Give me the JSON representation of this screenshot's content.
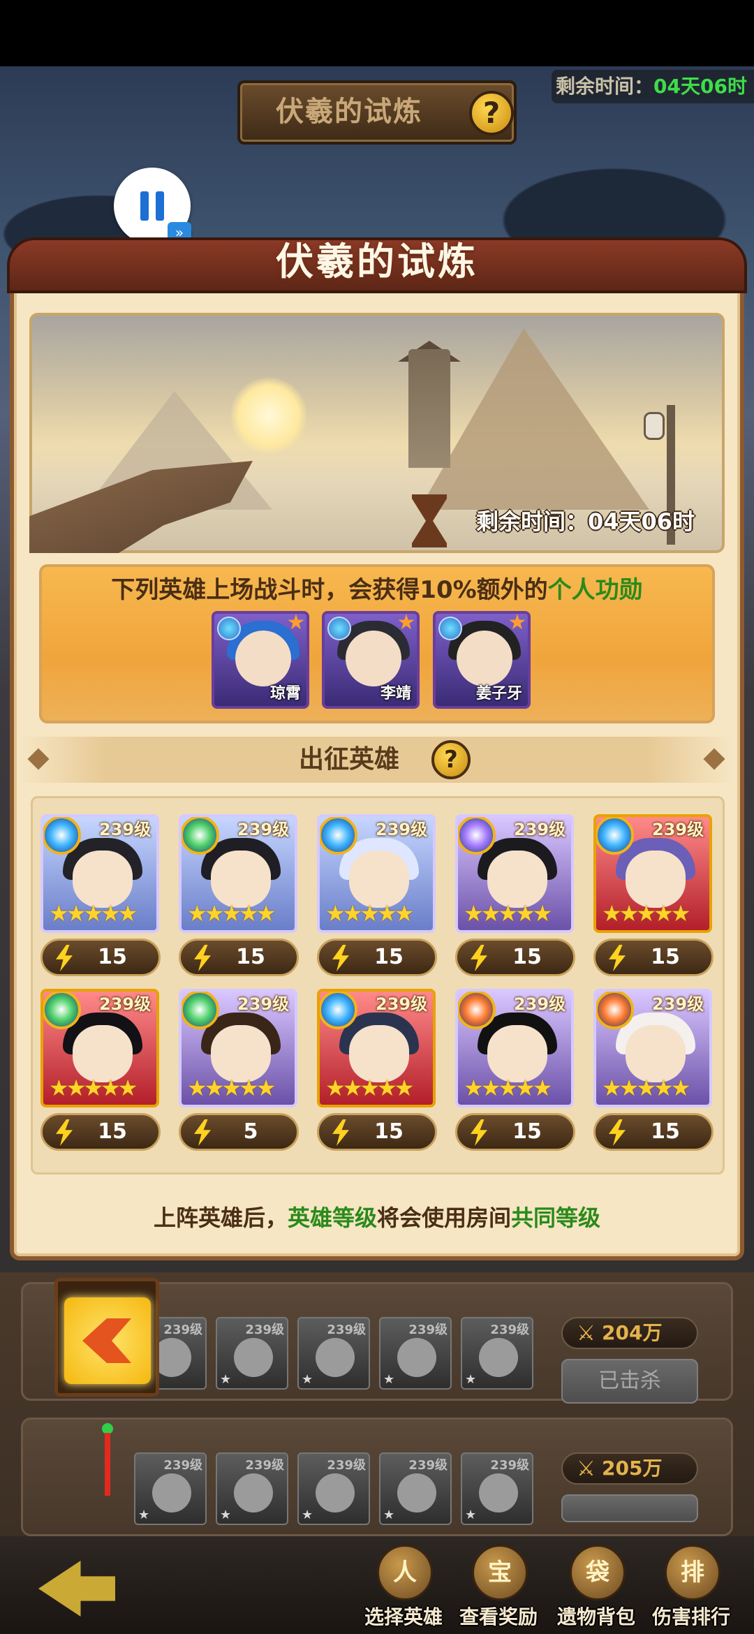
{
  "header": {
    "title": "伏羲的试炼",
    "help_label": "?",
    "remaining_label": "剩余时间：",
    "remaining_value": "04天06时"
  },
  "player": {
    "pause_icon": "pause-icon",
    "fast_forward_icon": "fast-forward-icon"
  },
  "panel": {
    "title": "伏羲的试炼",
    "scene_timer": "剩余时间：04天06时",
    "bonus_text_prefix": "下列英雄上场战斗时，会获得10%额外的",
    "bonus_text_highlight": "个人功勋",
    "bonus_heroes": [
      {
        "name": "琼霄",
        "hair": "#2a6fd1"
      },
      {
        "name": "李靖",
        "hair": "#2b2b33"
      },
      {
        "name": "姜子牙",
        "hair": "#222222"
      }
    ],
    "section_title": "出征英雄",
    "section_help": "?",
    "footer_prefix": "上阵英雄后，",
    "footer_hl1": "英雄等级",
    "footer_mid": "将会使用房间",
    "footer_hl2": "共同等级"
  },
  "heroes": [
    {
      "level": "239级",
      "stars": "★★★★★",
      "energy": "15",
      "frame": "blue",
      "elem": "#3fb5ff",
      "hair": "#222228"
    },
    {
      "level": "239级",
      "stars": "★★★★★",
      "energy": "15",
      "frame": "blue",
      "elem": "#4fd16a",
      "hair": "#1e1e24"
    },
    {
      "level": "239级",
      "stars": "★★★★★",
      "energy": "15",
      "frame": "blue",
      "elem": "#3fb5ff",
      "hair": "#dfe6ff"
    },
    {
      "level": "239级",
      "stars": "★★★★★",
      "energy": "15",
      "frame": "purple",
      "elem": "#a67dff",
      "hair": "#1b1b1f"
    },
    {
      "level": "239级",
      "stars": "★★★★★",
      "energy": "15",
      "frame": "red",
      "elem": "#3fb5ff",
      "hair": "#6b5fb8"
    },
    {
      "level": "239级",
      "stars": "★★★★★",
      "energy": "15",
      "frame": "red",
      "elem": "#4fd16a",
      "hair": "#111116"
    },
    {
      "level": "239级",
      "stars": "★★★★★",
      "energy": "5",
      "frame": "purple",
      "elem": "#4fd16a",
      "hair": "#3a2618"
    },
    {
      "level": "239级",
      "stars": "★★★★★",
      "energy": "15",
      "frame": "red",
      "elem": "#3fb5ff",
      "hair": "#2a3450"
    },
    {
      "level": "239级",
      "stars": "★★★★★",
      "energy": "15",
      "frame": "purple",
      "elem": "#ff7a2e",
      "hair": "#111111"
    },
    {
      "level": "239级",
      "stars": "★★★★★",
      "energy": "15",
      "frame": "purple",
      "elem": "#ff7a2e",
      "hair": "#f4f0ee"
    }
  ],
  "rank_rows": [
    {
      "heroes": [
        "239级",
        "239级",
        "239级",
        "239级",
        "239级"
      ],
      "power": "204万",
      "status": "已击杀"
    },
    {
      "heroes": [
        "239级",
        "239级",
        "239级",
        "239级",
        "239级"
      ],
      "power": "205万"
    }
  ],
  "bottom_nav": [
    {
      "label": "选择英雄",
      "glyph": "人"
    },
    {
      "label": "查看奖励",
      "glyph": "宝"
    },
    {
      "label": "遗物背包",
      "glyph": "袋"
    },
    {
      "label": "伤害排行",
      "glyph": "排"
    }
  ]
}
